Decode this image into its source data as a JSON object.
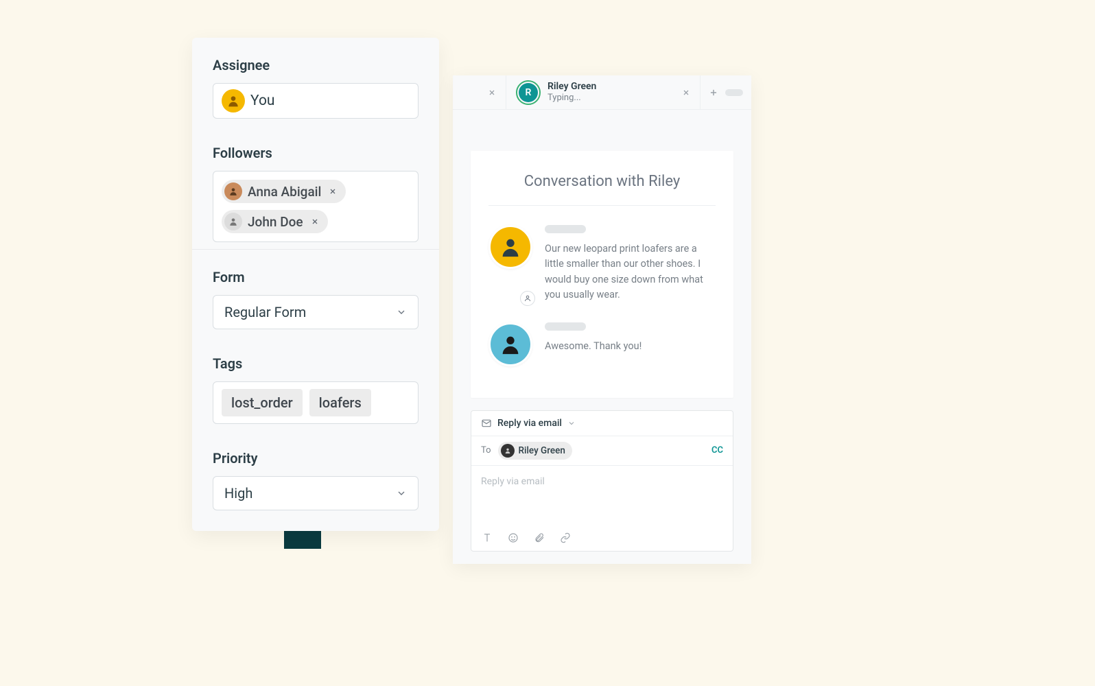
{
  "sidebar": {
    "assignee": {
      "label": "Assignee",
      "value": "You",
      "avatar_color": "#f5b800"
    },
    "followers": {
      "label": "Followers",
      "people": [
        {
          "name": "Anna Abigail",
          "avatar_color": "#c98a5b"
        },
        {
          "name": "John Doe",
          "avatar_color": "#dcdcdc"
        }
      ]
    },
    "form": {
      "label": "Form",
      "value": "Regular Form"
    },
    "tags": {
      "label": "Tags",
      "items": [
        "lost_order",
        "loafers"
      ]
    },
    "priority": {
      "label": "Priority",
      "value": "High"
    }
  },
  "tabs": {
    "active": {
      "name": "Riley Green",
      "status": "Typing...",
      "initial": "R"
    }
  },
  "conversation": {
    "title": "Conversation with Riley",
    "messages": [
      {
        "text": "Our new leopard print loafers are a little smaller than our other shoes. I would buy one size down from what you usually wear.",
        "avatar_color": "#f5b800",
        "has_badge": true
      },
      {
        "text": "Awesome. Thank you!",
        "avatar_color": "#5cbcd6",
        "has_badge": false
      }
    ]
  },
  "composer": {
    "mode_label": "Reply via email",
    "to_label": "To",
    "recipient": "Riley Green",
    "cc_label": "CC",
    "placeholder": "Reply via email"
  }
}
